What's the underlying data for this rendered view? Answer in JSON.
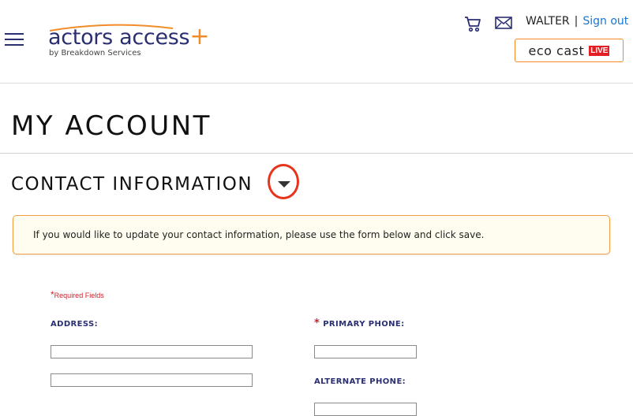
{
  "header": {
    "logo": {
      "main": "actors access",
      "plus": "+",
      "sub": "by Breakdown Services"
    },
    "icons": {
      "cart": "cart-icon",
      "mail": "mail-icon",
      "menu": "hamburger-menu-icon"
    },
    "user": {
      "name": "WALTER",
      "separator": "|",
      "signout_label": "Sign out"
    },
    "ecocast": {
      "label": "eco cast",
      "badge": "LIVE"
    }
  },
  "page": {
    "title": "MY ACCOUNT"
  },
  "section": {
    "title": "CONTACT INFORMATION",
    "toggle_icon": "caret-down-icon",
    "notice": "If you would like to update your contact information, please use the form below and click save."
  },
  "form": {
    "required_star": "*",
    "required_note": "Required Fields",
    "address_label": "ADDRESS:",
    "address_line1": "",
    "address_line2": "",
    "primary_phone_star": "*",
    "primary_phone_label": "PRIMARY PHONE:",
    "primary_phone": "",
    "alternate_phone_label": "ALTERNATE PHONE:",
    "alternate_phone": ""
  },
  "colors": {
    "brand_navy": "#2a2f72",
    "brand_orange": "#f28c28",
    "link_blue": "#1976d2",
    "required_red": "#d0202a",
    "highlight_red": "#e8341c",
    "notice_bg": "#fffdf0"
  }
}
